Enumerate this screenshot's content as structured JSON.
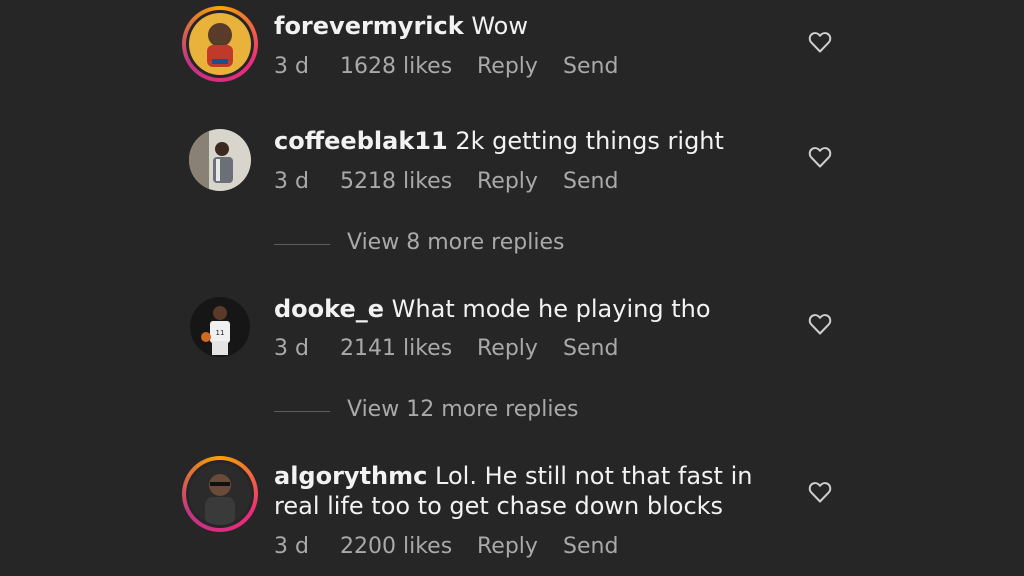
{
  "comments": [
    {
      "username": "forevermyrick",
      "text": "Wow",
      "age": "3 d",
      "likes": "1628 likes",
      "reply_label": "Reply",
      "send_label": "Send",
      "avatar_story_ring": true
    },
    {
      "username": "coffeeblak11",
      "text": "2k getting things right",
      "age": "3 d",
      "likes": "5218 likes",
      "reply_label": "Reply",
      "send_label": "Send",
      "avatar_story_ring": false,
      "view_replies": "View 8 more replies"
    },
    {
      "username": "dooke_e",
      "text": "What mode he playing tho",
      "age": "3 d",
      "likes": "2141 likes",
      "reply_label": "Reply",
      "send_label": "Send",
      "avatar_story_ring": false,
      "view_replies": "View 12 more replies"
    },
    {
      "username": "algorythmc",
      "text": "Lol. He still not that fast in real life too to get chase down blocks",
      "age": "3 d",
      "likes": "2200 likes",
      "reply_label": "Reply",
      "send_label": "Send",
      "avatar_story_ring": true
    }
  ],
  "icons": {
    "like": "heart-outline-icon"
  },
  "colors": {
    "background": "#262626",
    "primary_text": "#f2f2f2",
    "secondary_text": "#a9a9a9",
    "story_ring_start": "#f7a400",
    "story_ring_end": "#c13584"
  }
}
